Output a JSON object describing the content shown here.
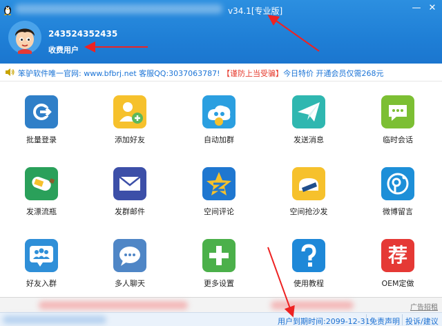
{
  "window": {
    "title_version": "v34.1[专业版]",
    "minimize": "—",
    "close": "✕"
  },
  "user": {
    "id": "243524352435",
    "type": "收费用户"
  },
  "notice": {
    "part1": "笨驴软件唯一官网: www.bfbrj.net 客服QQ:3037063787!",
    "part2": " 【谨防上当受骗】",
    "part3": "今日特价 开通会员仅需268元"
  },
  "apps": [
    {
      "label": "批量登录",
      "icon": "login-icon",
      "color": "#2f7fc8"
    },
    {
      "label": "添加好友",
      "icon": "add-friend-icon",
      "color": "#f6c12c"
    },
    {
      "label": "自动加群",
      "icon": "auto-join-group-icon",
      "color": "#2b9fe0"
    },
    {
      "label": "发送消息",
      "icon": "send-message-icon",
      "color": "#2fb7b0"
    },
    {
      "label": "临时会话",
      "icon": "temp-chat-icon",
      "color": "#7cbf33"
    },
    {
      "label": "发漂流瓶",
      "icon": "drift-bottle-icon",
      "color": "#2aa05a"
    },
    {
      "label": "发群邮件",
      "icon": "group-mail-icon",
      "color": "#3c4fa8"
    },
    {
      "label": "空间评论",
      "icon": "qzone-comment-icon",
      "color": "#1f77d0"
    },
    {
      "label": "空间抢沙发",
      "icon": "qzone-sofa-icon",
      "color": "#f6c12c"
    },
    {
      "label": "微博留言",
      "icon": "weibo-message-icon",
      "color": "#1d8fd8"
    },
    {
      "label": "好友入群",
      "icon": "friends-join-group-icon",
      "color": "#2f8fd8"
    },
    {
      "label": "多人聊天",
      "icon": "multi-chat-icon",
      "color": "#4f86c6"
    },
    {
      "label": "更多设置",
      "icon": "more-settings-icon",
      "color": "#4bb04a"
    },
    {
      "label": "使用教程",
      "icon": "help-tutorial-icon",
      "color": "#1e88d8"
    },
    {
      "label": "OEM定做",
      "icon": "oem-custom-icon",
      "color": "#e53935",
      "glyph": "荐"
    }
  ],
  "footer": {
    "ad_link": "广告招租",
    "expire": "用户到期时间:2099-12-31",
    "statement": "免责声明",
    "feedback": "投诉/建议"
  }
}
